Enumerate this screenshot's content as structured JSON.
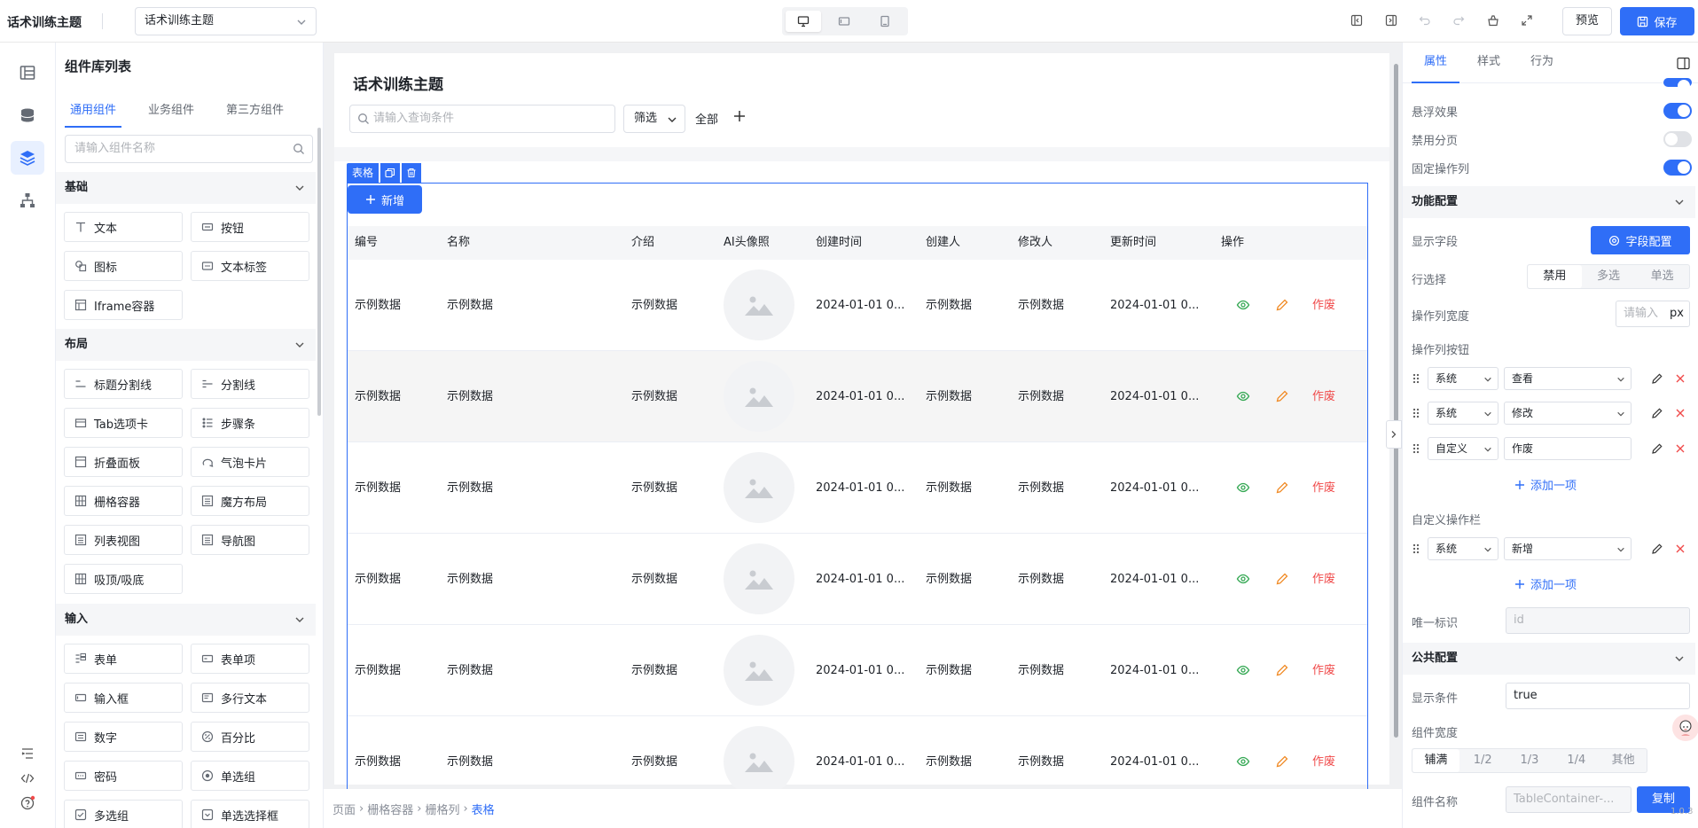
{
  "topbar": {
    "app_title": "话术训练主题",
    "page_select": "话术训练主题",
    "preview_label": "预览",
    "save_label": "保存"
  },
  "left_panel": {
    "title": "组件库列表",
    "tabs": [
      "通用组件",
      "业务组件",
      "第三方组件"
    ],
    "search_placeholder": "请输入组件名称",
    "groups": {
      "basic": {
        "title": "基础",
        "items": [
          "文本",
          "按钮",
          "图标",
          "文本标签",
          "Iframe容器"
        ]
      },
      "layout": {
        "title": "布局",
        "items": [
          "标题分割线",
          "分割线",
          "Tab选项卡",
          "步骤条",
          "折叠面板",
          "气泡卡片",
          "栅格容器",
          "魔方布局",
          "列表视图",
          "导航图",
          "吸顶/吸底"
        ]
      },
      "input": {
        "title": "输入",
        "items": [
          "表单",
          "表单项",
          "输入框",
          "多行文本",
          "数字",
          "百分比",
          "密码",
          "单选组",
          "多选组",
          "单选选择框"
        ]
      }
    }
  },
  "canvas": {
    "page_title": "话术训练主题",
    "query_placeholder": "请输入查询条件",
    "filter_label": "筛选",
    "all_label": "全部",
    "selected_tag": "表格",
    "add_button": "新增",
    "columns": [
      "编号",
      "名称",
      "介绍",
      "AI头像照",
      "创建时间",
      "创建人",
      "修改人",
      "更新时间",
      "操作"
    ],
    "rows": [
      {
        "id": "示例数据",
        "name": "示例数据",
        "intro": "示例数据",
        "created": "2024-01-01 0...",
        "creator": "示例数据",
        "modifier": "示例数据",
        "updated": "2024-01-01 0...",
        "delete": "作废"
      },
      {
        "id": "示例数据",
        "name": "示例数据",
        "intro": "示例数据",
        "created": "2024-01-01 0...",
        "creator": "示例数据",
        "modifier": "示例数据",
        "updated": "2024-01-01 0...",
        "delete": "作废"
      },
      {
        "id": "示例数据",
        "name": "示例数据",
        "intro": "示例数据",
        "created": "2024-01-01 0...",
        "creator": "示例数据",
        "modifier": "示例数据",
        "updated": "2024-01-01 0...",
        "delete": "作废"
      },
      {
        "id": "示例数据",
        "name": "示例数据",
        "intro": "示例数据",
        "created": "2024-01-01 0...",
        "creator": "示例数据",
        "modifier": "示例数据",
        "updated": "2024-01-01 0...",
        "delete": "作废"
      },
      {
        "id": "示例数据",
        "name": "示例数据",
        "intro": "示例数据",
        "created": "2024-01-01 0...",
        "creator": "示例数据",
        "modifier": "示例数据",
        "updated": "2024-01-01 0...",
        "delete": "作废"
      },
      {
        "id": "示例数据",
        "name": "示例数据",
        "intro": "示例数据",
        "created": "2024-01-01 0...",
        "creator": "示例数据",
        "modifier": "示例数据",
        "updated": "2024-01-01 0...",
        "delete": "作废"
      }
    ],
    "breadcrumb": [
      "页面",
      "栅格容器",
      "栅格列",
      "表格"
    ]
  },
  "right_panel": {
    "tabs": [
      "属性",
      "样式",
      "行为"
    ],
    "hover_effect": {
      "label": "悬浮效果",
      "on": true
    },
    "disable_paging": {
      "label": "禁用分页",
      "on": false
    },
    "fix_action_col": {
      "label": "固定操作列",
      "on": true
    },
    "func_config": {
      "title": "功能配置",
      "display_fields_label": "显示字段",
      "field_config_button": "字段配置",
      "row_select_label": "行选择",
      "row_select_options": [
        "禁用",
        "多选",
        "单选"
      ],
      "action_col_width_label": "操作列宽度",
      "action_col_width_placeholder": "请输入",
      "action_col_width_unit": "px",
      "action_buttons_label": "操作列按钮",
      "action_buttons": [
        {
          "type": "系统",
          "value": "查看"
        },
        {
          "type": "系统",
          "value": "修改"
        },
        {
          "type": "自定义",
          "value": "作废"
        }
      ],
      "add_item_label": "添加一项",
      "custom_actions_label": "自定义操作栏",
      "custom_actions": [
        {
          "type": "系统",
          "value": "新增"
        }
      ],
      "unique_key_label": "唯一标识",
      "unique_key_placeholder": "id"
    },
    "public_config": {
      "title": "公共配置",
      "show_condition_label": "显示条件",
      "show_condition_value": "true",
      "width_label": "组件宽度",
      "width_options": [
        "铺满",
        "1/2",
        "1/3",
        "1/4",
        "其他"
      ],
      "name_label": "组件名称",
      "name_value": "TableContainer-...",
      "copy_label": "复制"
    },
    "version": "1.0.3"
  },
  "colors": {
    "accent": "#2f6ef7",
    "danger": "#f04a4a",
    "view_icon": "#34a853",
    "edit_icon": "#f08a24"
  }
}
